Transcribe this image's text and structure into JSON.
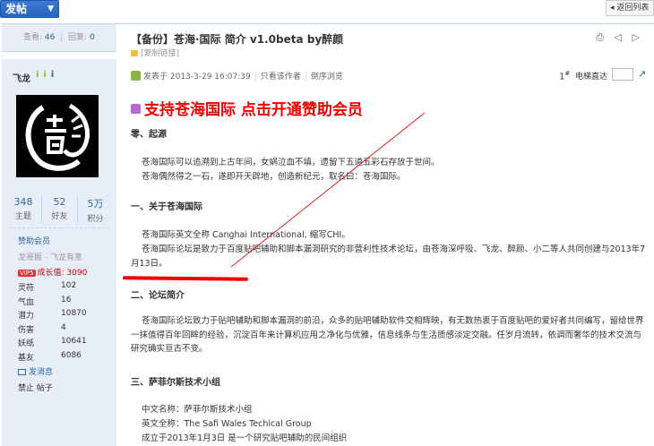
{
  "toolbar": {
    "post_label": "发帖",
    "post_arrow": "▼",
    "back_label": "◂ 返回列表"
  },
  "thread": {
    "views_label": "查看:",
    "views": "46",
    "sep": "|",
    "replies_label": "回复:",
    "replies": "0",
    "title": "【备份】苍海·国际 简介 v1.0beta by醉颜",
    "copy_link": "[复制链接]",
    "header_icons": "⎙ ◁ ▷"
  },
  "author": {
    "name": "飞龙",
    "online_marks": [
      "i",
      "i",
      "i"
    ],
    "stats": [
      {
        "value": "348",
        "label": "主题"
      },
      {
        "value": "52",
        "label": "好友"
      },
      {
        "value": "5万",
        "label": "积分"
      }
    ],
    "group": "赞助会员",
    "title": "龙哥握 - 飞龙有意",
    "vip_badge": "VIP5",
    "growth": "成长值: 3090",
    "props": [
      {
        "k": "灵符",
        "v": "102"
      },
      {
        "k": "气血",
        "v": "16"
      },
      {
        "k": "潜力",
        "v": "10870"
      },
      {
        "k": "伤害",
        "v": "4"
      },
      {
        "k": "妖纸",
        "v": "10641"
      },
      {
        "k": "基友",
        "v": "6086"
      }
    ],
    "send_msg": "发消息",
    "ban_label": "禁止 帖子"
  },
  "post": {
    "posted_label": "发表于 2013-3-29 16:07:39",
    "only_author": "只看该作者",
    "reverse": "倒序浏览",
    "floor": "1",
    "floor_sup": "#",
    "jump_label": "电梯直达",
    "jump_icon": "↗",
    "banner": "支持苍海国际  点击开通赞助会员",
    "s1_title": "零、起源",
    "s1_p1": "苍海国际可以追溯到上古年间，女娲泣血不填，遗留下五道五彩石存放于世间。",
    "s1_p2": "苍海偶然得之一石，遂即开天辟地，创造新纪元，取名曰：苍海国际。",
    "s2_title": "一、关于苍海国际",
    "s2_p1": "苍海国际英文全称  Canghai International, 缩写CHI。",
    "s2_p2": "苍海国际论坛是致力于百度贴吧辅助和脚本漏洞研究的非营利性技术论坛，由苍海深呼吸、飞龙、醉颜、小二等人共同创建与2013年7月13日。",
    "s3_title": "二、论坛简介",
    "s3_p1": "苍海国际论坛致力于贴吧辅助和脚本漏洞的前沿，众多的贴吧辅助软件交相辉映，有无数热衷于百度贴吧的爱好者共同编写，留给世界一抹值得百年回眸的经验，沉淀百年来计算机应用之净化与优雅，信息线条与生活质感淡定交融。任岁月流转，依调而奢华的技术交流与研究确实亘古不变。",
    "s4_title": "三、萨菲尔斯技术小组",
    "s4_p1": "中文名称：萨菲尔斯技术小组",
    "s4_p2": "英文全称：The Safi Wales Techical Group",
    "s4_p3": "成立于2013年1月3日  是一个研究贴吧辅助的民间组织"
  }
}
